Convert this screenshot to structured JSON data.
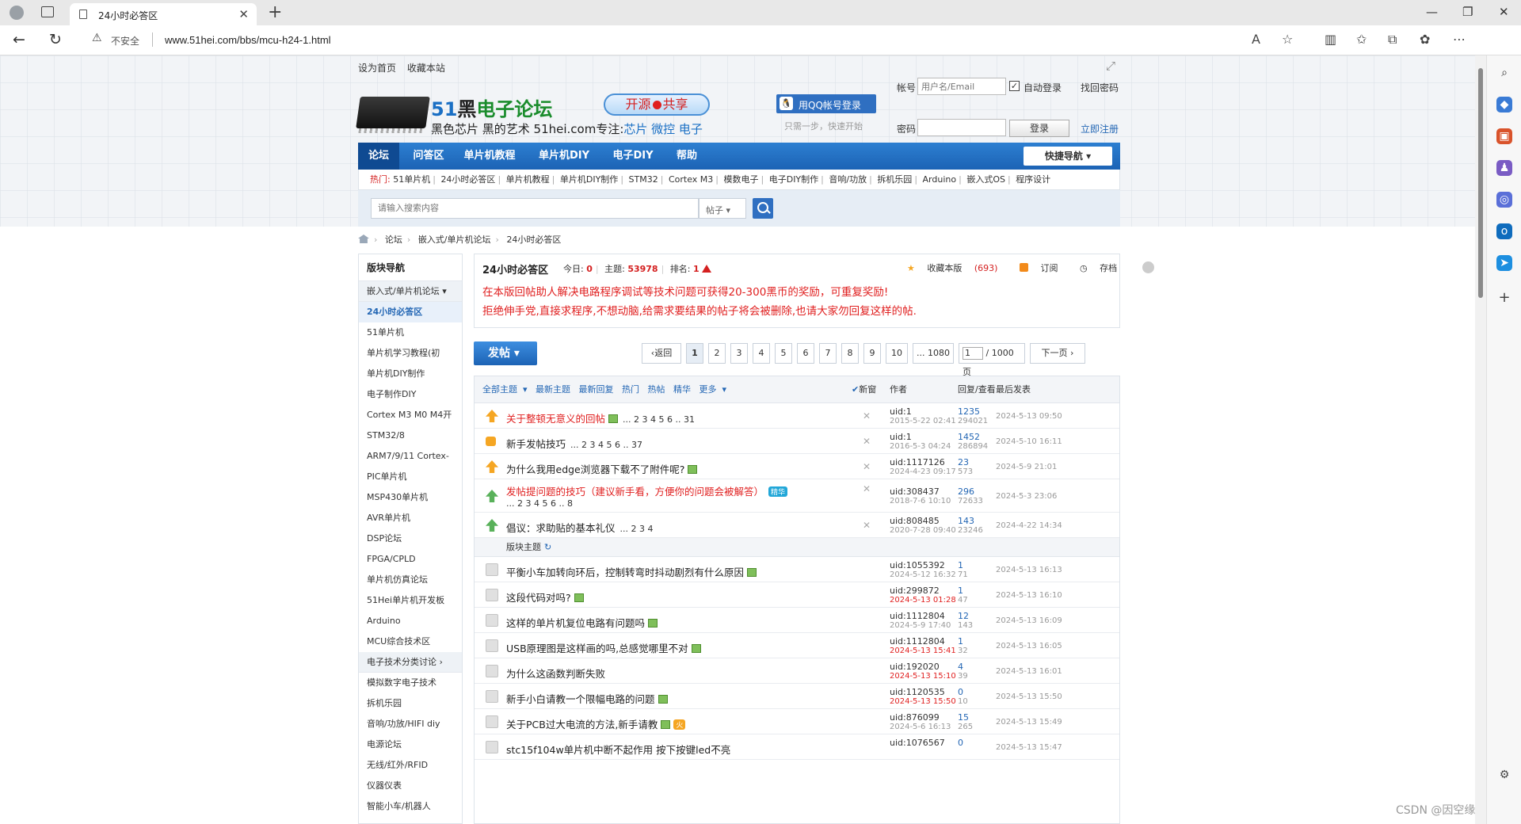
{
  "browser": {
    "tab_title": "24小时必答区",
    "insecure_label": "不安全",
    "url": "www.51hei.com/bbs/mcu-h24-1.html"
  },
  "header": {
    "set_home": "设为首页",
    "bookmark": "收藏本站",
    "brand_51": "51",
    "brand_hei": "黑",
    "brand_rest": "电子论坛",
    "slogan_prefix": "黑色芯片 黑的艺术 51hei.com专注:",
    "slogan_topics": "芯片 微控 电子",
    "share_left": "开源",
    "share_right": "共享",
    "qq_login": "用QQ帐号登录",
    "qq_sub": "只需一步，快速开始",
    "account_label": "帐号",
    "account_placeholder": "用户名/Email",
    "auto_login": "自动登录",
    "find_password": "找回密码",
    "password_label": "密码",
    "login_button": "登录",
    "register": "立即注册"
  },
  "nav": {
    "items": [
      "论坛",
      "问答区",
      "单片机教程",
      "单片机DIY",
      "电子DIY",
      "帮助"
    ],
    "quick_nav": "快捷导航"
  },
  "hotbar": {
    "label": "热门:",
    "links": [
      "51单片机",
      "24小时必答区",
      "单片机教程",
      "单片机DIY制作",
      "STM32",
      "Cortex M3",
      "模数电子",
      "电子DIY制作",
      "音响/功放",
      "拆机乐园",
      "Arduino",
      "嵌入式OS",
      "程序设计"
    ]
  },
  "search": {
    "placeholder": "请输入搜索内容",
    "type": "帖子"
  },
  "breadcrumb": [
    "论坛",
    "嵌入式/单片机论坛",
    "24小时必答区"
  ],
  "leftnav": {
    "title": "版块导航",
    "group1": "嵌入式/单片机论坛",
    "group1_items": [
      "24小时必答区",
      "51单片机",
      "单片机学习教程(初",
      "单片机DIY制作",
      "电子制作DIY",
      "Cortex M3 M0 M4开",
      "STM32/8",
      "ARM7/9/11 Cortex-",
      "PIC单片机",
      "MSP430单片机",
      "AVR单片机",
      "DSP论坛",
      "FPGA/CPLD",
      "单片机仿真论坛",
      "51Hei单片机开发板",
      "Arduino",
      "MCU综合技术区"
    ],
    "group2": "电子技术分类讨论",
    "group2_items": [
      "模拟数字电子技术",
      "拆机乐园",
      "音响/功放/HIFI diy",
      "电源论坛",
      "无线/红外/RFID",
      "仪器仪表",
      "智能小车/机器人"
    ]
  },
  "forum": {
    "name": "24小时必答区",
    "today_label": "今日:",
    "today": "0",
    "topics_label": "主题:",
    "topics": "53978",
    "rank_label": "排名:",
    "rank": "1",
    "favorite": "收藏本版",
    "favorite_count": "(693)",
    "subscribe": "订阅",
    "archive": "存档",
    "notice_line1": "在本版回帖助人解决电路程序调试等技术问题可获得20-300黑币的奖励，可重复奖励!",
    "notice_line2": "拒绝伸手党,直接求程序,不想动脑,给需求要结果的帖子将会被删除,也请大家勿回复这样的帖."
  },
  "post_button": "发帖",
  "pager": {
    "back": "返回",
    "pages": [
      "1",
      "2",
      "3",
      "4",
      "5",
      "6",
      "7",
      "8",
      "9",
      "10"
    ],
    "last": "... 1080",
    "input": "1",
    "total": "/ 1000 页",
    "next": "下一页"
  },
  "thread_header": {
    "filters": [
      "全部主题",
      "最新主题",
      "最新回复",
      "热门",
      "热帖",
      "精华",
      "更多"
    ],
    "new_window": "新窗",
    "author": "作者",
    "reply_view": "回复/查看",
    "last_post": "最后发表"
  },
  "sticky": [
    {
      "title": "关于整顿无意义的回帖",
      "red": true,
      "icon": "pin",
      "pages": "... 2 3 4 5 6 .. 31",
      "author": "uid:1",
      "date": "2015-5-22 02:41",
      "replies": "1235",
      "views": "294021",
      "last": "2024-5-13 09:50"
    },
    {
      "title": "新手发帖技巧",
      "red": false,
      "icon": "lock",
      "pages": "... 2 3 4 5 6 .. 37",
      "author": "uid:1",
      "date": "2016-5-3 04:24",
      "replies": "1452",
      "views": "286894",
      "last": "2024-5-10 16:11"
    },
    {
      "title": "为什么我用edge浏览器下载不了附件呢?",
      "red": false,
      "icon": "pin",
      "pages": "",
      "author": "uid:1117126",
      "date": "2024-4-23 09:17",
      "replies": "23",
      "views": "573",
      "last": "2024-5-9 21:01"
    },
    {
      "title": "发帖提问题的技巧（建议新手看，方便你的问题会被解答）",
      "red": true,
      "icon": "green",
      "pages": "... 2 3 4 5 6 .. 8",
      "tag": "精华",
      "author": "uid:308437",
      "date": "2018-7-6 10:10",
      "replies": "296",
      "views": "72633",
      "last": "2024-5-3 23:06"
    },
    {
      "title": "倡议：求助贴的基本礼仪",
      "red": false,
      "icon": "green",
      "pages": "... 2 3 4",
      "author": "uid:808485",
      "date": "2020-7-28 09:40",
      "replies": "143",
      "views": "23246",
      "last": "2024-4-22 14:34"
    }
  ],
  "section_label": "版块主题",
  "threads": [
    {
      "title": "平衡小车加转向环后，控制转弯时抖动剧烈有什么原因",
      "author": "uid:1055392",
      "date": "2024-5-12 16:32",
      "date_red": false,
      "replies": "1",
      "views": "71",
      "last": "2024-5-13 16:13"
    },
    {
      "title": "这段代码对吗?",
      "author": "uid:299872",
      "date": "2024-5-13 01:28",
      "date_red": true,
      "replies": "1",
      "views": "47",
      "last": "2024-5-13 16:10"
    },
    {
      "title": "这样的单片机复位电路有问题吗",
      "author": "uid:1112804",
      "date": "2024-5-9 17:40",
      "date_red": false,
      "replies": "12",
      "views": "143",
      "last": "2024-5-13 16:09"
    },
    {
      "title": "USB原理图是这样画的吗,总感觉哪里不对",
      "author": "uid:1112804",
      "date": "2024-5-13 15:41",
      "date_red": true,
      "replies": "1",
      "views": "32",
      "last": "2024-5-13 16:05"
    },
    {
      "title": "为什么这函数判断失败",
      "author": "uid:192020",
      "date": "2024-5-13 15:10",
      "date_red": true,
      "replies": "4",
      "views": "39",
      "last": "2024-5-13 16:01"
    },
    {
      "title": "新手小白请教一个限幅电路的问题",
      "author": "uid:1120535",
      "date": "2024-5-13 15:50",
      "date_red": true,
      "replies": "0",
      "views": "10",
      "last": "2024-5-13 15:50"
    },
    {
      "title": "关于PCB过大电流的方法,新手请教",
      "author": "uid:876099",
      "date": "2024-5-6 16:13",
      "date_red": false,
      "replies": "15",
      "views": "265",
      "last": "2024-5-13 15:49",
      "hot": "火"
    },
    {
      "title": "stc15f104w单片机中断不起作用 按下按键led不亮",
      "author": "uid:1076567",
      "date": "",
      "date_red": false,
      "replies": "0",
      "views": "",
      "last": "2024-5-13 15:47"
    }
  ],
  "watermark": "CSDN @因空缘"
}
